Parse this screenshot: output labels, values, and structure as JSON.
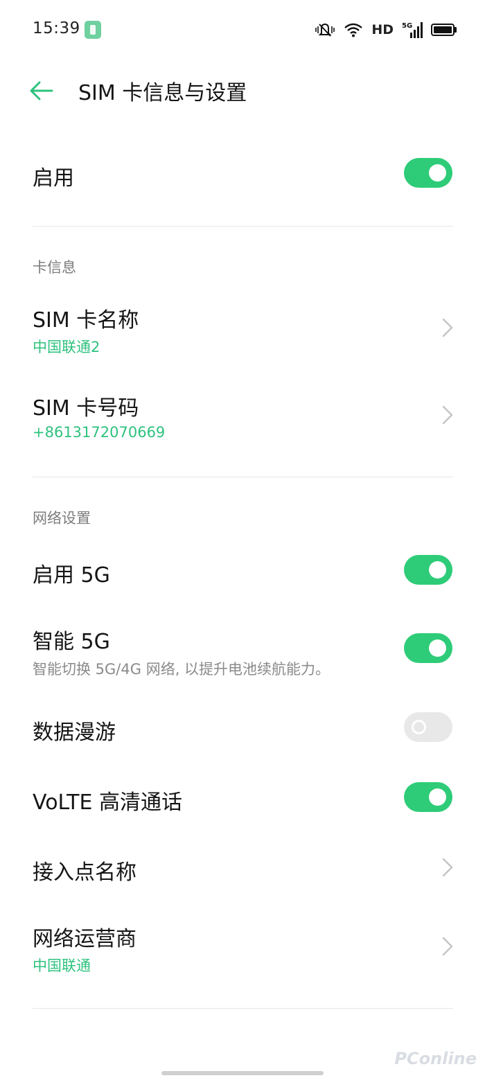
{
  "status_bar": {
    "time": "15:39",
    "hd_label": "HD",
    "network_label": "5G",
    "icons": [
      "sim-app-icon",
      "mute-bell-icon",
      "wifi-icon",
      "signal-icon",
      "battery-icon"
    ]
  },
  "header": {
    "title": "SIM 卡信息与设置",
    "back_icon": "arrow-left-icon"
  },
  "enable": {
    "label": "启用",
    "state": true
  },
  "card_info": {
    "section_label": "卡信息",
    "sim_name": {
      "label": "SIM 卡名称",
      "value": "中国联通2"
    },
    "sim_number": {
      "label": "SIM 卡号码",
      "value": "+8613172070669"
    }
  },
  "network": {
    "section_label": "网络设置",
    "enable_5g": {
      "label": "启用 5G",
      "state": true
    },
    "smart_5g": {
      "label": "智能 5G",
      "description": "智能切换 5G/4G 网络, 以提升电池续航能力。",
      "state": true
    },
    "data_roaming": {
      "label": "数据漫游",
      "state": false
    },
    "volte": {
      "label": "VoLTE 高清通话",
      "state": true
    },
    "apn": {
      "label": "接入点名称"
    },
    "operator": {
      "label": "网络运营商",
      "value": "中国联通"
    }
  },
  "watermark": "PConline",
  "colors": {
    "accent": "#2ecc78",
    "accent_text": "#2ec27e",
    "toggle_off": "#e8e8e8",
    "divider": "#e6e6e6"
  }
}
